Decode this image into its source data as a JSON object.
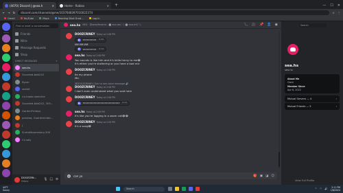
{
  "browser": {
    "tabs": [
      {
        "label": "(4070) Discord | @sea.h",
        "active": true
      },
      {
        "label": "Home - Roblox",
        "active": false
      }
    ],
    "new_tab": "+",
    "url": "discord.com/channels/@me/1037648397010022374",
    "bookmarks": [
      "Gmail",
      "YouTube",
      "Maps",
      "Reading Bind Grad...",
      "Log In"
    ]
  },
  "dm_panel": {
    "search_placeholder": "Find or start a conversation",
    "nav": [
      "Friends",
      "Nitro",
      "Message Requests",
      "Shop"
    ],
    "header": "DIRECT MESSAGES",
    "add": "+",
    "dms": [
      {
        "name": "sea.hs",
        "active": true
      },
      {
        "name": "Guarded-bbb242",
        "active": false
      },
      {
        "name": "Ryzer",
        "active": false
      },
      {
        "name": "sexbit",
        "active": false
      },
      {
        "name": "rui.blade.sketchie",
        "active": false
      },
      {
        "name": "Guarded-bbb242, 305...",
        "active": false
      },
      {
        "name": "GardenFridays",
        "active": false
      },
      {
        "name": "pandaq, Guarded-bbb...",
        "active": false
      },
      {
        "name": "J",
        "active": false
      },
      {
        "name": "SuntoMoonestary.309",
        "active": false
      },
      {
        "name": "Ct-lady",
        "active": false
      }
    ]
  },
  "user_bar": {
    "name": "DOOZCRN...",
    "status": "Online"
  },
  "chat_header": {
    "name": "sea.hs",
    "members": "NHL",
    "extra": "@seaofesonb.. ⬤ sea.ae(♡) ⬤ sea.ml(♡)",
    "search_placeholder": "Search"
  },
  "messages": [
    {
      "author": "DOOZCRINEY",
      "time": "Today at 2:08 PM",
      "voice": "0:06",
      "lines": [],
      "avatar": "b"
    },
    {
      "author": "",
      "time": "",
      "voice": "",
      "lines": [
        "ИИ ИИ ИИ"
      ],
      "avatar": ""
    },
    {
      "author": "",
      "time": "",
      "voice": "0:14",
      "lines": [],
      "avatar": ""
    },
    {
      "author": "sea.hs",
      "time": "Today at 2:08 PM",
      "voice": "",
      "lines": [
        "You sounds is like him and it's hella funny to me😂",
        "It's either you're stuttering or you have a bad mic"
      ],
      "avatar": "a"
    },
    {
      "author": "DOOZCRINEY",
      "time": "Today at 2:08 PM",
      "voice": "",
      "lines": [
        "Its my phone",
        "Mic"
      ],
      "avatar": "b"
    },
    {
      "author": "DOOZCRINEY",
      "time": "Today at 2:08 PM",
      "voice": "",
      "lines": [
        "I don't even understand what you said here"
      ],
      "avatar": "b",
      "reply": "@DOOZCRINEY Click to see voice message 🔊"
    },
    {
      "author": "DOOZCRINEY",
      "time": "Today at 2:08 PM",
      "voice": "0:24",
      "lines": [],
      "avatar": "b"
    },
    {
      "author": "sea.hs",
      "time": "Today at 2:09 PM",
      "voice": "",
      "lines": [
        "It's like you're lagging in a zoom call😂😂"
      ],
      "avatar": "a"
    },
    {
      "author": "DOOZCRINEY",
      "time": "Today at 2:09 PM",
      "voice": "",
      "lines": [
        "It's a song😂"
      ],
      "avatar": "b"
    }
  ],
  "composer": {
    "value": "can yo"
  },
  "profile": {
    "name": "sea.hs",
    "username": "sea.hs",
    "about_label": "About Me",
    "about": "Clent",
    "since_label": "Member Since",
    "since": "Apr 6, 2022",
    "mutual_servers": "Mutual Servers — 4",
    "mutual_friends": "Mutual Friends — 5",
    "view_full": "View Full Profile"
  },
  "taskbar": {
    "temp": "44°F",
    "weather": "Sunny",
    "search": "Search",
    "time": "2:11 PM",
    "date": "1/8/2024"
  }
}
